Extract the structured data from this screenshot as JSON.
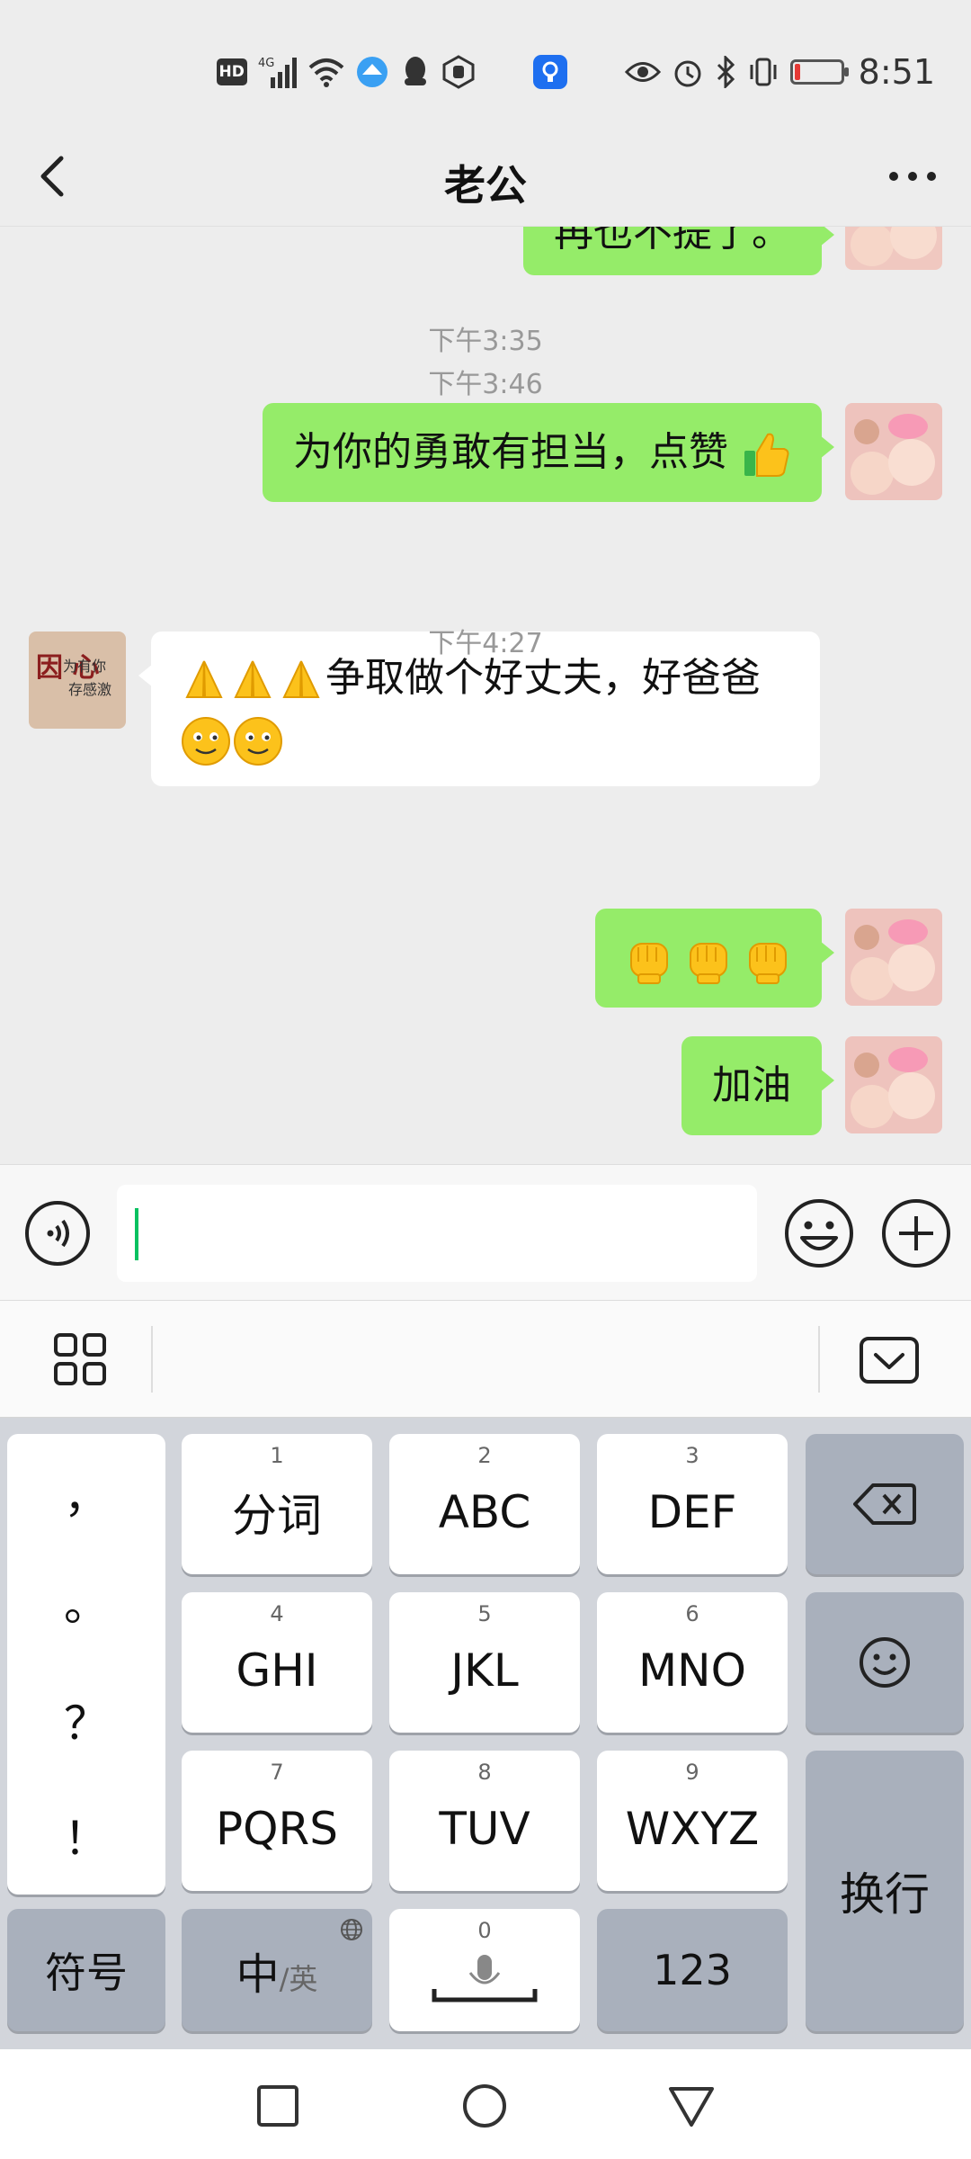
{
  "status_bar": {
    "network": "4G",
    "hd_label": "HD",
    "time": "8:51",
    "battery_level": 0.12,
    "icons": [
      "hd-icon",
      "signal-icon",
      "wifi-icon",
      "app-icon",
      "qq-icon",
      "hand-icon",
      "app-blue-icon",
      "eye-icon",
      "alarm-icon",
      "bluetooth-icon",
      "vibrate-icon",
      "battery-icon"
    ]
  },
  "header": {
    "title": "老公",
    "back_icon": "chevron-left-icon",
    "more_icon": "more-icon"
  },
  "chat": {
    "partial_message": "再也不提了。",
    "items": [
      {
        "type": "time",
        "text": "下午3:35"
      },
      {
        "type": "msg",
        "side": "right",
        "text": "为你的勇敢有担当，点赞",
        "emoji": "thumbs-up-icon"
      },
      {
        "type": "time",
        "text": "下午3:46"
      },
      {
        "type": "msg",
        "side": "left",
        "line1": "争取做个好丈夫，好爸爸",
        "emoji_before": "pray-icon",
        "emoji_after": "smile-icon"
      },
      {
        "type": "time",
        "text": "下午4:27"
      },
      {
        "type": "msg",
        "side": "right",
        "emoji": "fist-icon"
      },
      {
        "type": "msg",
        "side": "right",
        "text": "加油"
      }
    ],
    "contact_avatar_text": [
      "为有你",
      "存感激"
    ],
    "contact_avatar_glyphs": "因 心"
  },
  "input_bar": {
    "voice_icon": "voice-icon",
    "emoji_icon": "emoji-icon",
    "plus_icon": "plus-icon",
    "value": ""
  },
  "keyboard": {
    "toolbar": {
      "apps_icon": "grid-icon",
      "hide_icon": "keyboard-hide-icon"
    },
    "punctuation": [
      "，",
      "。",
      "？",
      "！"
    ],
    "keys": [
      {
        "num": "1",
        "label": "分词"
      },
      {
        "num": "2",
        "label": "ABC"
      },
      {
        "num": "3",
        "label": "DEF"
      },
      {
        "num": "4",
        "label": "GHI"
      },
      {
        "num": "5",
        "label": "JKL"
      },
      {
        "num": "6",
        "label": "MNO"
      },
      {
        "num": "7",
        "label": "PQRS"
      },
      {
        "num": "8",
        "label": "TUV"
      },
      {
        "num": "9",
        "label": "WXYZ"
      }
    ],
    "symbol_label": "符号",
    "lang_main": "中",
    "lang_sub": "/英",
    "space_num": "0",
    "num_label": "123",
    "enter_label": "换行"
  },
  "nav_bar": {
    "recent_icon": "square-icon",
    "home_icon": "circle-icon",
    "back_icon": "triangle-icon"
  }
}
